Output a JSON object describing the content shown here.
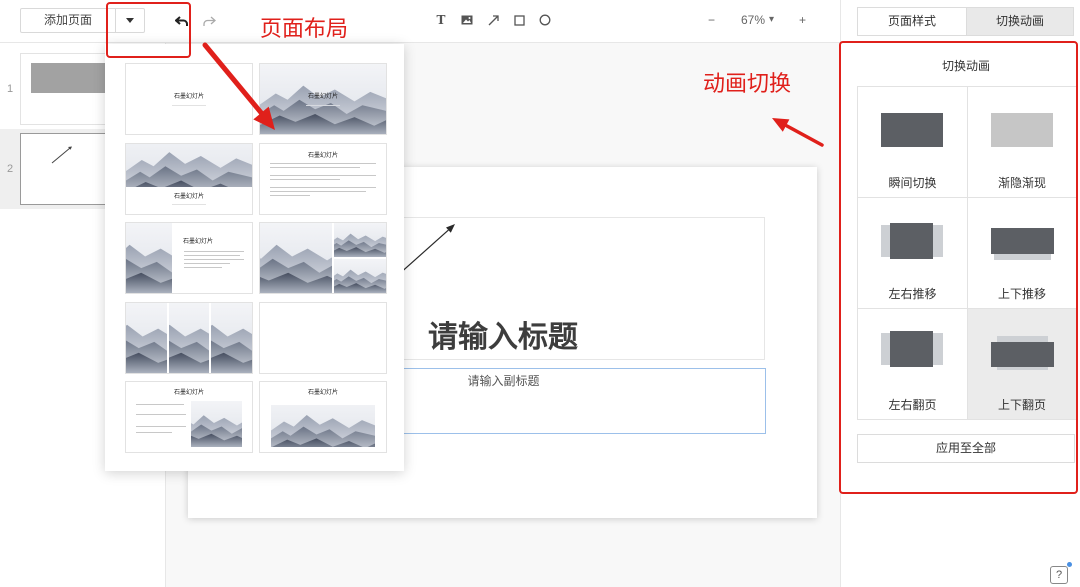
{
  "toolbar": {
    "add_page_label": "添加页面",
    "layout_dropdown_icon": "caret-down-icon",
    "undo_icon": "undo-icon",
    "redo_icon": "redo-icon",
    "insert_tools": [
      {
        "icon": "text-tool-icon",
        "glyph": "T"
      },
      {
        "icon": "image-tool-icon"
      },
      {
        "icon": "arrow-tool-icon"
      },
      {
        "icon": "rectangle-tool-icon"
      },
      {
        "icon": "ellipse-tool-icon"
      }
    ],
    "zoom": {
      "decrease": "−",
      "value": "67%",
      "caret": "▾",
      "increase": "+"
    }
  },
  "side_tabs": [
    {
      "label": "页面样式",
      "active": false
    },
    {
      "label": "切换动画",
      "active": true
    }
  ],
  "transition_panel": {
    "title": "切换动画",
    "options": [
      {
        "label": "瞬间切换",
        "icon": "instant-switch-icon"
      },
      {
        "label": "渐隐渐现",
        "icon": "fade-icon"
      },
      {
        "label": "左右推移",
        "icon": "push-horizontal-icon"
      },
      {
        "label": "上下推移",
        "icon": "push-vertical-icon"
      },
      {
        "label": "左右翻页",
        "icon": "flip-horizontal-icon"
      },
      {
        "label": "上下翻页",
        "icon": "flip-vertical-icon",
        "selected": true
      }
    ],
    "apply_all_label": "应用至全部"
  },
  "slide_list": [
    {
      "number": "1"
    },
    {
      "number": "2",
      "selected": true
    }
  ],
  "canvas": {
    "title_placeholder": "请输入标题",
    "subtitle_placeholder": "请输入副标题"
  },
  "layout_popup": {
    "thumbnail_title": "石墨幻灯片"
  },
  "annotations": {
    "layout_callout": "页面布局",
    "transition_callout": "动画切换",
    "color": "#e0201b"
  },
  "help": {
    "icon": "help-icon",
    "glyph": "?"
  },
  "colors": {
    "selection_border": "#9cc0ea",
    "active_tab": "#e9e9e9",
    "transition_icon_dark": "#5c5f64",
    "transition_icon_light": "#cdd0d4"
  }
}
